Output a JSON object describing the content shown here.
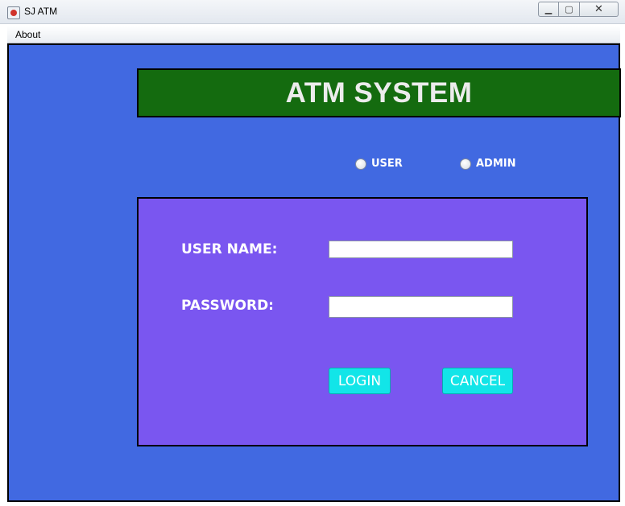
{
  "window": {
    "title": "SJ ATM",
    "controls": {
      "minimize": "▁",
      "maximize": "▢",
      "close": "✕"
    }
  },
  "menubar": {
    "items": [
      {
        "label": "About"
      }
    ]
  },
  "banner": {
    "title": "ATM SYSTEM"
  },
  "role_selector": {
    "options": [
      {
        "label": "USER",
        "checked": false
      },
      {
        "label": "ADMIN",
        "checked": false
      }
    ]
  },
  "login_form": {
    "username_label": "USER NAME:",
    "username_value": "",
    "password_label": "PASSWORD:",
    "password_value": "",
    "login_button": "LOGIN",
    "cancel_button": "CANCEL"
  },
  "colors": {
    "window_background": "#4169e1",
    "banner_background": "#146b0f",
    "panel_background": "#7a56f0",
    "button_background": "#12e5e8"
  }
}
